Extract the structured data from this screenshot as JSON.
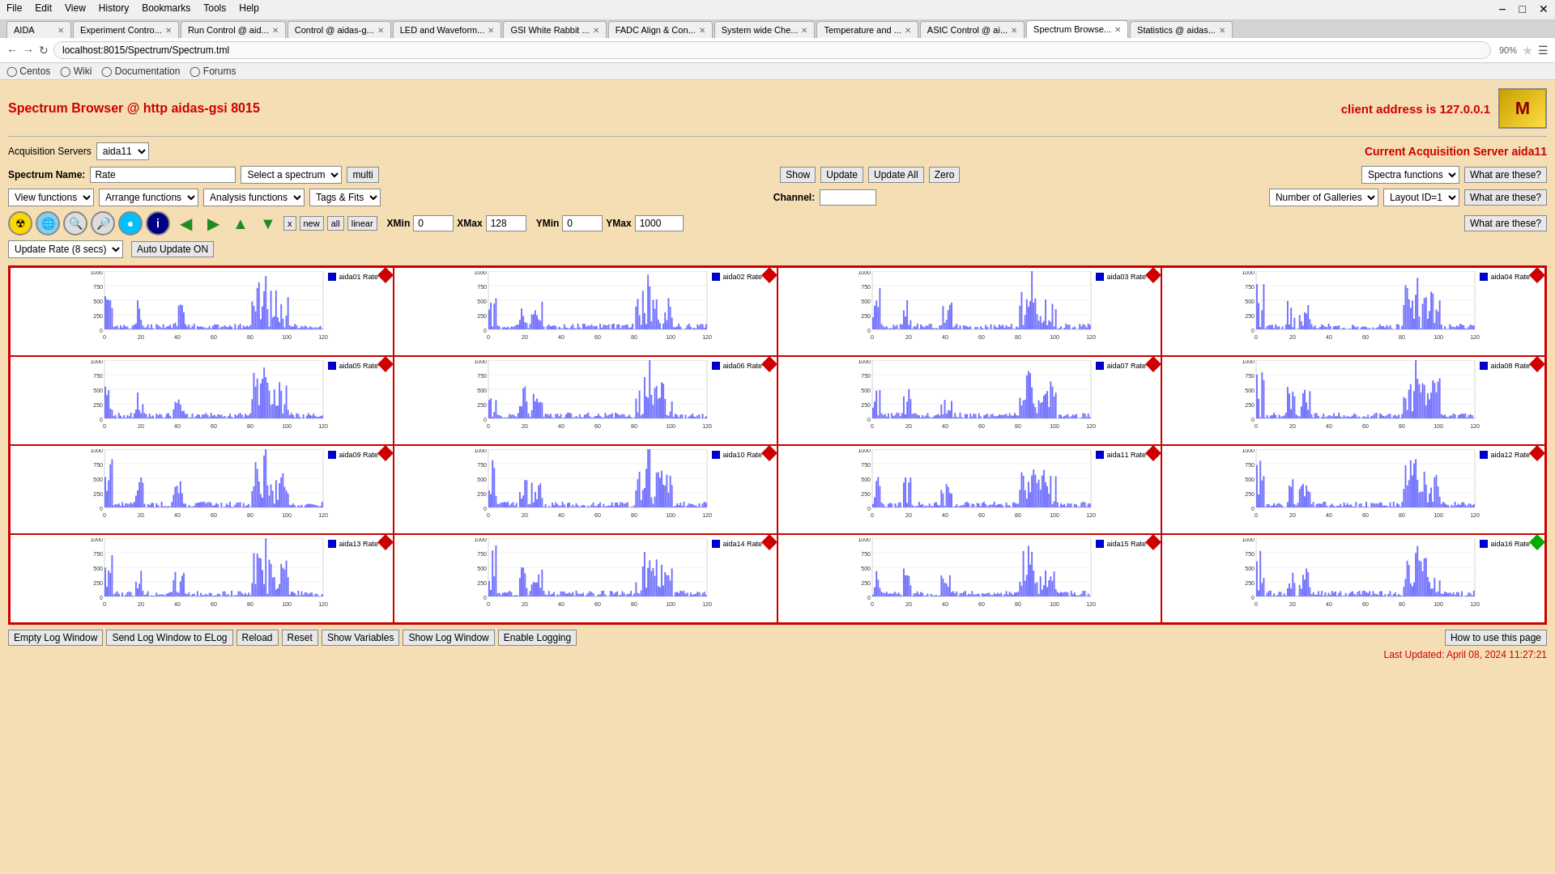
{
  "browser": {
    "menu_items": [
      "File",
      "Edit",
      "View",
      "History",
      "Bookmarks",
      "Tools",
      "Help"
    ],
    "tabs": [
      {
        "label": "AIDA",
        "active": false
      },
      {
        "label": "Experiment Contro...",
        "active": false
      },
      {
        "label": "Run Control @ aid...",
        "active": false
      },
      {
        "label": "Control @ aidas-g...",
        "active": false
      },
      {
        "label": "LED and Waveform...",
        "active": false
      },
      {
        "label": "GSI White Rabbit ...",
        "active": false
      },
      {
        "label": "FADC Align & Con...",
        "active": false
      },
      {
        "label": "System wide Che...",
        "active": false
      },
      {
        "label": "Temperature and ...",
        "active": false
      },
      {
        "label": "ASIC Control @ ai...",
        "active": false
      },
      {
        "label": "Spectrum Browse...",
        "active": true
      },
      {
        "label": "Statistics @ aidas...",
        "active": false
      }
    ],
    "address": "localhost:8015/Spectrum/Spectrum.tml",
    "zoom": "90%",
    "bookmarks": [
      "Centos",
      "Wiki",
      "Documentation",
      "Forums"
    ]
  },
  "page": {
    "title": "Spectrum Browser @ http aidas-gsi 8015",
    "client_address_label": "client address is 127.0.0.1"
  },
  "controls": {
    "acq_servers_label": "Acquisition Servers",
    "acq_server_value": "aida11",
    "current_server_label": "Current Acquisition Server aida11",
    "spectrum_name_label": "Spectrum Name:",
    "spectrum_name_value": "Rate",
    "select_spectrum_label": "Select a spectrum",
    "multi_label": "multi",
    "show_label": "Show",
    "update_label": "Update",
    "update_all_label": "Update All",
    "zero_label": "Zero",
    "spectra_functions_label": "Spectra functions",
    "what_these_label": "What are these?",
    "view_functions_label": "View functions",
    "arrange_functions_label": "Arrange functions",
    "analysis_functions_label": "Analysis functions",
    "tags_fits_label": "Tags & Fits",
    "channel_label": "Channel:",
    "channel_value": "",
    "number_of_galleries_label": "Number of Galleries",
    "layout_id_label": "Layout ID=1",
    "what_these2_label": "What are these?",
    "x_btn": "x",
    "new_btn": "new",
    "all_btn": "all",
    "linear_btn": "linear",
    "xmin_label": "XMin",
    "xmin_value": "0",
    "xmax_label": "XMax",
    "xmax_value": "128",
    "ymin_label": "YMin",
    "ymin_value": "0",
    "ymax_label": "YMax",
    "ymax_value": "1000",
    "what_these3_label": "What are these?",
    "update_rate_label": "Update Rate (8 secs)",
    "auto_update_label": "Auto Update ON"
  },
  "galleries": [
    {
      "id": 1,
      "label": "aida01 Rate",
      "diamond": "red"
    },
    {
      "id": 2,
      "label": "aida02 Rate",
      "diamond": "red"
    },
    {
      "id": 3,
      "label": "aida03 Rate",
      "diamond": "red"
    },
    {
      "id": 4,
      "label": "aida04 Rate",
      "diamond": "red"
    },
    {
      "id": 5,
      "label": "aida05 Rate",
      "diamond": "red"
    },
    {
      "id": 6,
      "label": "aida06 Rate",
      "diamond": "red"
    },
    {
      "id": 7,
      "label": "aida07 Rate",
      "diamond": "red"
    },
    {
      "id": 8,
      "label": "aida08 Rate",
      "diamond": "red"
    },
    {
      "id": 9,
      "label": "aida09 Rate",
      "diamond": "red"
    },
    {
      "id": 10,
      "label": "aida10 Rate",
      "diamond": "red"
    },
    {
      "id": 11,
      "label": "aida11 Rate",
      "diamond": "red"
    },
    {
      "id": 12,
      "label": "aida12 Rate",
      "diamond": "red"
    },
    {
      "id": 13,
      "label": "aida13 Rate",
      "diamond": "red"
    },
    {
      "id": 14,
      "label": "aida14 Rate",
      "diamond": "red"
    },
    {
      "id": 15,
      "label": "aida15 Rate",
      "diamond": "red"
    },
    {
      "id": 16,
      "label": "aida16 Rate",
      "diamond": "green"
    }
  ],
  "bottom": {
    "buttons": [
      "Empty Log Window",
      "Send Log Window to ELog",
      "Reload",
      "Reset",
      "Show Variables",
      "Show Log Window",
      "Enable Logging"
    ],
    "how_to_label": "How to use this page",
    "last_updated_label": "Last Updated: April 08, 2024 11:27:21"
  }
}
